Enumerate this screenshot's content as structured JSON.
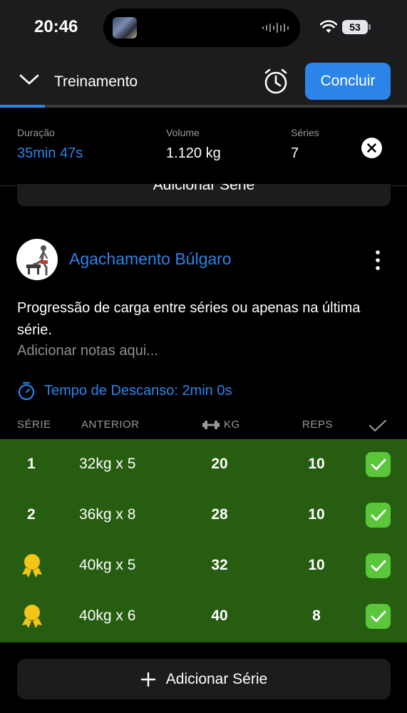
{
  "status_bar": {
    "time": "20:46",
    "battery": "53"
  },
  "header": {
    "title": "Treinamento",
    "finish_label": "Concluir"
  },
  "workout_progress": 0.11,
  "summary": {
    "duration_label": "Duração",
    "duration_value": "35min 47s",
    "volume_label": "Volume",
    "volume_value": "1.120 kg",
    "sets_label": "Séries",
    "sets_value": "7"
  },
  "previous_add_label": "Adicionar Série",
  "exercise": {
    "name": "Agachamento Búlgaro",
    "description": "Progressão de carga entre séries ou apenas na última série.",
    "notes_placeholder": "Adicionar notas aqui...",
    "rest_label": "Tempo de Descanso: 2min 0s"
  },
  "table": {
    "headers": {
      "set": "SÉRIE",
      "previous": "ANTERIOR",
      "kg": "KG",
      "reps": "REPS"
    },
    "rows": [
      {
        "set": "1",
        "previous": "32kg x 5",
        "kg": "20",
        "reps": "10",
        "record": false
      },
      {
        "set": "2",
        "previous": "36kg x 8",
        "kg": "28",
        "reps": "10",
        "record": false
      },
      {
        "set": "",
        "previous": "40kg x 5",
        "kg": "32",
        "reps": "10",
        "record": true
      },
      {
        "set": "",
        "previous": "40kg x 6",
        "kg": "40",
        "reps": "8",
        "record": true
      }
    ]
  },
  "add_set_label": "Adicionar Série",
  "colors": {
    "accent": "#2c84e8",
    "completed_row": "#265d10",
    "check": "#5ac63a",
    "medal": "#f5c518"
  },
  "icons": [
    "chevron-down-icon",
    "stopwatch-icon",
    "close-icon",
    "more-vertical-icon",
    "timer-icon",
    "dumbbell-icon",
    "checkmark-icon",
    "medal-icon",
    "plus-icon"
  ]
}
